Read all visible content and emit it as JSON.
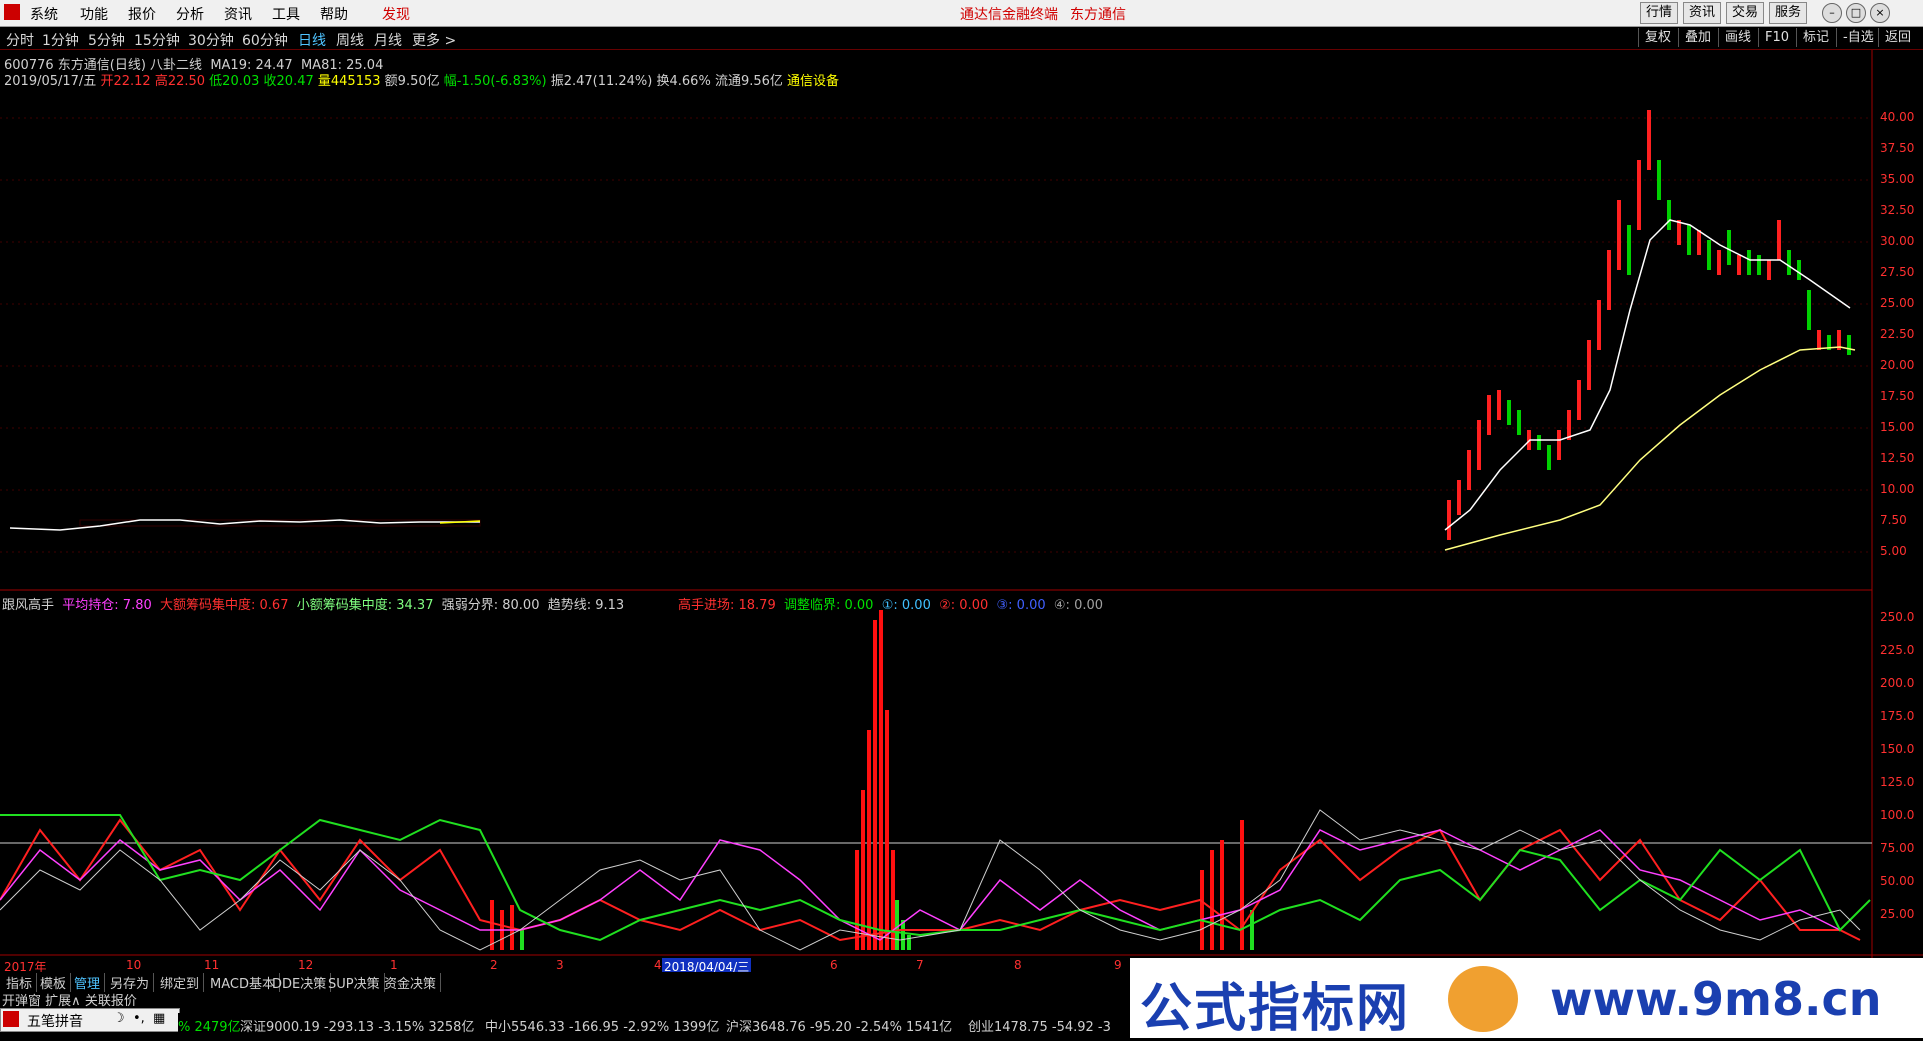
{
  "menu": {
    "items": [
      "系统",
      "功能",
      "报价",
      "分析",
      "资讯",
      "工具",
      "帮助"
    ],
    "find": "发现",
    "center_title": "通达信金融终端",
    "center_broker": "东方通信",
    "right_buttons": [
      "行情",
      "资讯",
      "交易",
      "服务"
    ]
  },
  "period_bar": {
    "periods": [
      "分时",
      "1分钟",
      "5分钟",
      "15分钟",
      "30分钟",
      "60分钟",
      "日线",
      "周线",
      "月线",
      "更多 >"
    ],
    "active": "日线",
    "tools": [
      "复权",
      "叠加",
      "画线",
      "F10",
      "标记",
      "-自选",
      "返回"
    ]
  },
  "stock_info": {
    "code_name": "600776 东方通信(日线) 八卦二线",
    "ma19": "MA19: 24.47",
    "ma81": "MA81: 25.04",
    "date": "2019/05/17/五",
    "open": "开22.12",
    "high": "高22.50",
    "low": "低20.03",
    "close": "收20.47",
    "volume": "量445153",
    "amount": "额9.50亿",
    "change": "幅-1.50(-6.83%)",
    "amplitude": "振2.47(11.24%)",
    "turnover": "换4.66%",
    "float": "流通9.56亿",
    "sector": "通信设备"
  },
  "price_axis": [
    "40.00",
    "37.50",
    "35.00",
    "32.50",
    "30.00",
    "27.50",
    "25.00",
    "22.50",
    "20.00",
    "17.50",
    "15.00",
    "12.50",
    "10.00",
    "7.50",
    "5.00"
  ],
  "indicator": {
    "name": "跟风高手",
    "avg_hold": "平均持仓: 7.80",
    "big_conc": "大额筹码集中度: 0.67",
    "small_conc": "小额筹码集中度: 34.37",
    "strong_weak": "强弱分界: 80.00",
    "trend": "趋势线: 9.13",
    "master_in": "高手进场: 18.79",
    "adjust": "调整临界: 0.00",
    "v1": "①: 0.00",
    "v2": "②: 0.00",
    "v3": "③: 0.00",
    "v4": "④: 0.00"
  },
  "indicator_axis": [
    "250.0",
    "225.0",
    "200.0",
    "175.0",
    "150.0",
    "125.0",
    "100.0",
    "75.00",
    "50.00",
    "25.00"
  ],
  "time_axis": [
    "2017年",
    "10",
    "11",
    "12",
    "1",
    "2",
    "3",
    "4",
    "2018/04/04/三",
    "6",
    "7",
    "8",
    "9"
  ],
  "bottom_tabs": [
    "指标",
    "模板",
    "管理",
    "另存为",
    "绑定到",
    "MACD基本",
    "DDE决策",
    "SUP决策",
    "资金决策"
  ],
  "active_tab": "管理",
  "side_tabs": [
    "开弹窗",
    "扩展∧",
    "关联报价"
  ],
  "ime_label": "五笔拼音",
  "ticker": [
    {
      "text": "% 2479亿",
      "cls": "g"
    },
    {
      "text": "深证9000.19 -293.13 -3.15% 3258亿",
      "cls": "mix"
    },
    {
      "text": "中小5546.33 -166.95 -2.92% 1399亿",
      "cls": "mix"
    },
    {
      "text": "沪深3648.76 -95.20 -2.54% 1541亿",
      "cls": "mix"
    },
    {
      "text": "创业1478.75 -54.92 -3",
      "cls": "mix"
    }
  ],
  "watermark": {
    "brand": "公式指标网",
    "url": "www.9m8.cn"
  }
}
